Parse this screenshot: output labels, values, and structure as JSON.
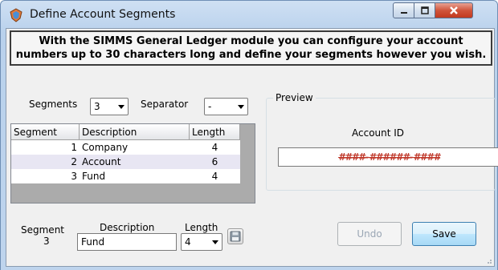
{
  "window": {
    "title": "Define Account Segments",
    "icon": "shield-app-icon",
    "controls": {
      "minimize_icon": "minimize-icon",
      "maximize_icon": "maximize-icon",
      "close_icon": "close-icon"
    }
  },
  "banner": {
    "text": "With the SIMMS General Ledger module you can configure your account numbers up to 30 characters long and define your segments however you wish."
  },
  "config": {
    "segments_label": "Segments",
    "segments_value": "3",
    "separator_label": "Separator",
    "separator_value": "-"
  },
  "grid": {
    "columns": [
      "Segment",
      "Description",
      "Length"
    ],
    "rows": [
      {
        "segment": "1",
        "description": "Company",
        "length": "4"
      },
      {
        "segment": "2",
        "description": "Account",
        "length": "6"
      },
      {
        "segment": "3",
        "description": "Fund",
        "length": "4"
      }
    ]
  },
  "preview": {
    "legend": "Preview",
    "account_id_label": "Account ID",
    "account_mask": "####-######-####"
  },
  "editor": {
    "segment_label": "Segment",
    "segment_value": "3",
    "description_label": "Description",
    "description_value": "Fund",
    "length_label": "Length",
    "length_value": "4",
    "save_icon": "floppy-disk-icon"
  },
  "buttons": {
    "undo": "Undo",
    "save": "Save"
  },
  "colors": {
    "mask_text": "#c0392b",
    "close_button": "#c8462c",
    "selected_row": "#e8e6f3"
  }
}
